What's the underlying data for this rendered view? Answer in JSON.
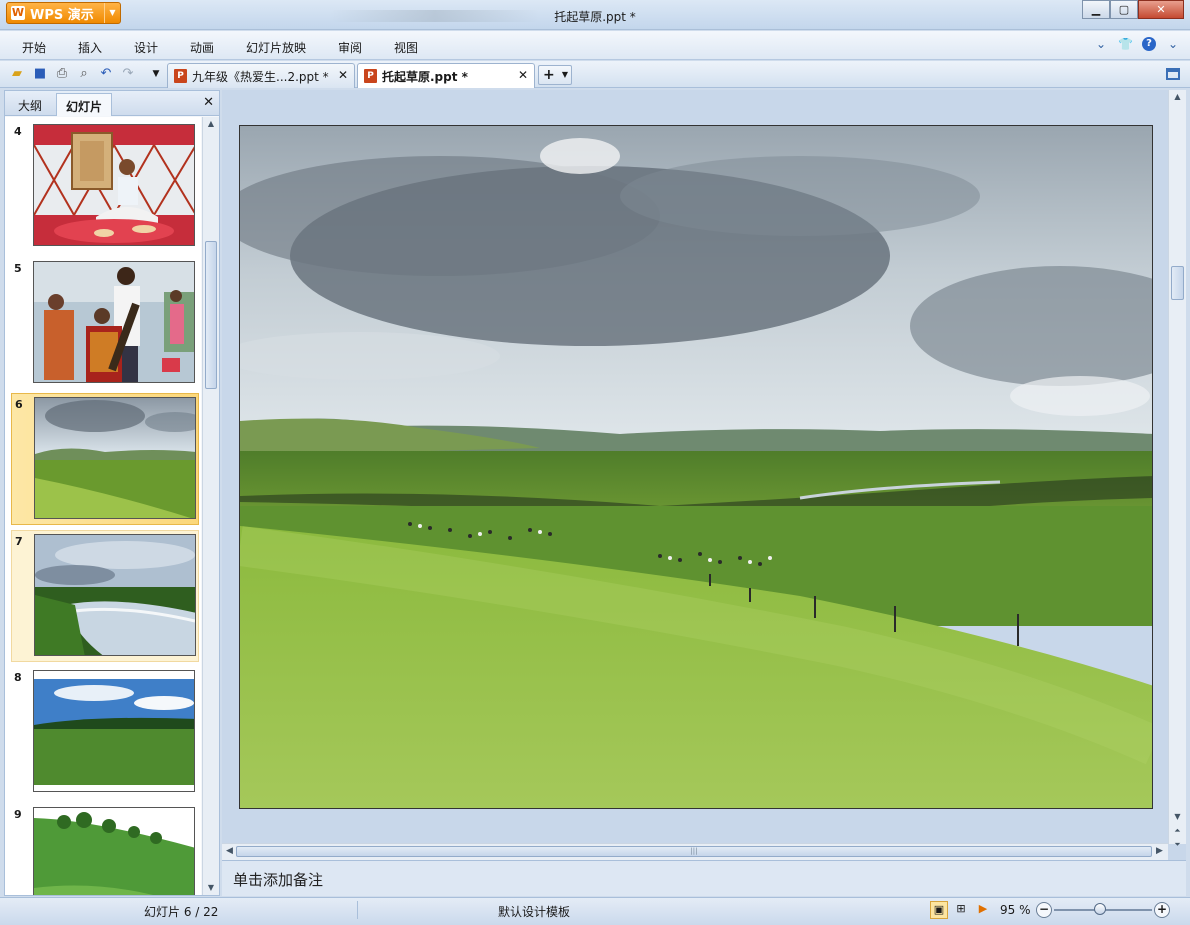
{
  "app": {
    "menu_button": "WPS 演示",
    "window_title": "托起草原.ppt *"
  },
  "menu": {
    "items": [
      "开始",
      "插入",
      "设计",
      "动画",
      "幻灯片放映",
      "审阅",
      "视图"
    ]
  },
  "toolbar": {
    "icons": [
      "open-folder-icon",
      "save-icon",
      "print-icon",
      "print-preview-icon",
      "undo-icon",
      "redo-icon",
      "customize-dropdown-icon"
    ]
  },
  "tabs": [
    {
      "label": "九年级《热爱生...2.ppt *",
      "active": false
    },
    {
      "label": "托起草原.ppt *",
      "active": true
    }
  ],
  "left_panel": {
    "tabs": [
      "大纲",
      "幻灯片"
    ],
    "active_tab": "幻灯片",
    "thumbnails": [
      {
        "number": "4",
        "description": "yurt interior photo"
      },
      {
        "number": "5",
        "description": "musicians group photo"
      },
      {
        "number": "6",
        "description": "grassland landscape",
        "selected": true
      },
      {
        "number": "7",
        "description": "river through grassland"
      },
      {
        "number": "8",
        "description": "blue sky green field"
      },
      {
        "number": "9",
        "description": "green hill with trees"
      }
    ]
  },
  "notes": {
    "placeholder": "单击添加备注"
  },
  "status": {
    "slide_indicator": "幻灯片 6 / 22",
    "template": "默认设计模板",
    "zoom": "95 %"
  },
  "colors": {
    "wps_orange": "#f08a00",
    "chrome_blue": "#cfdcec",
    "selection": "#fbd77a"
  }
}
